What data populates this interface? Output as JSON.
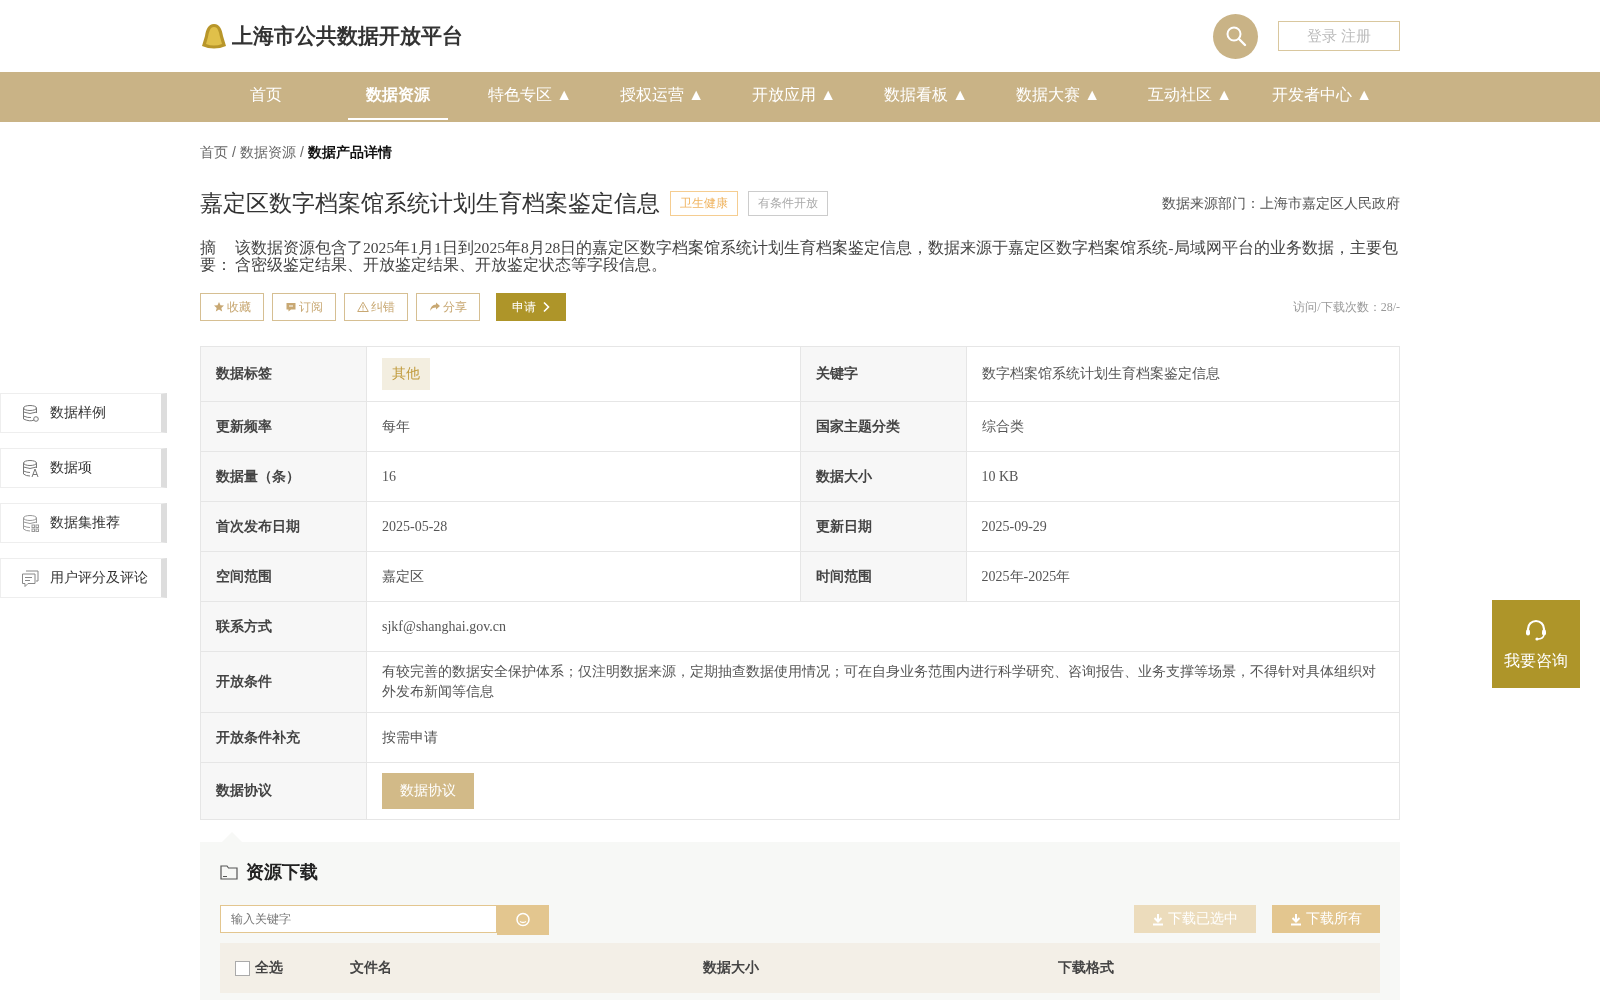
{
  "header": {
    "site_title": "上海市公共数据开放平台",
    "login_button": "登录 注册"
  },
  "nav": [
    {
      "label": "首页",
      "selected": false
    },
    {
      "label": "数据资源",
      "selected": true
    },
    {
      "label": "特色专区 ▲",
      "selected": false
    },
    {
      "label": "授权运营 ▲",
      "selected": false
    },
    {
      "label": "开放应用 ▲",
      "selected": false
    },
    {
      "label": "数据看板 ▲",
      "selected": false
    },
    {
      "label": "数据大赛 ▲",
      "selected": false
    },
    {
      "label": "互动社区 ▲",
      "selected": false
    },
    {
      "label": "开发者中心 ▲",
      "selected": false
    }
  ],
  "breadcrumb": [
    {
      "label": "首页",
      "current": false,
      "separator": "/"
    },
    {
      "label": "数据资源",
      "current": false,
      "separator": "/"
    },
    {
      "label": "数据产品详情",
      "current": true
    }
  ],
  "product": {
    "title": "嘉定区数字档案馆系统计划生育档案鉴定信息",
    "tags": [
      {
        "label": "卫生健康",
        "kind": "category"
      },
      {
        "label": "有条件开放",
        "kind": "access"
      }
    ],
    "source": "数据来源部门：上海市嘉定区人民政府",
    "abstract_label": "摘要：",
    "abstract": "该数据资源包含了2025年1月1日到2025年8月28日的嘉定区数字档案馆系统计划生育档案鉴定信息，数据来源于嘉定区数字档案馆系统-局域网平台的业务数据，主要包含密级鉴定结果、开放鉴定结果、开放鉴定状态等字段信息。",
    "actions": [
      {
        "label": "收藏",
        "kind": "star"
      },
      {
        "label": "订阅",
        "kind": "subscribe"
      },
      {
        "label": "纠错",
        "kind": "warning"
      },
      {
        "label": "分享",
        "kind": "share"
      },
      {
        "label": "申请",
        "kind": "apply"
      }
    ],
    "visits": "访问/下载次数：28/-"
  },
  "info_table": [
    {
      "fields": [
        {
          "label": "数据标签",
          "value": "其他",
          "kind": "tag"
        },
        {
          "label": "关键字",
          "value": "数字档案馆系统计划生育档案鉴定信息",
          "kind": "text"
        }
      ]
    },
    {
      "fields": [
        {
          "label": "更新频率",
          "value": "每年",
          "kind": "text"
        },
        {
          "label": "国家主题分类",
          "value": "综合类",
          "kind": "text"
        }
      ]
    },
    {
      "fields": [
        {
          "label": "数据量（条）",
          "value": "16",
          "kind": "text"
        },
        {
          "label": "数据大小",
          "value": "10 KB",
          "kind": "text"
        }
      ]
    },
    {
      "fields": [
        {
          "label": "首次发布日期",
          "value": "2025-05-28",
          "kind": "text"
        },
        {
          "label": "更新日期",
          "value": "2025-09-29",
          "kind": "text"
        }
      ]
    },
    {
      "fields": [
        {
          "label": "空间范围",
          "value": "嘉定区",
          "kind": "text"
        },
        {
          "label": "时间范围",
          "value": "2025年-2025年",
          "kind": "text"
        }
      ]
    },
    {
      "fields": [
        {
          "label": "联系方式",
          "value": "sjkf@shanghai.gov.cn",
          "kind": "text"
        }
      ]
    },
    {
      "fields": [
        {
          "label": "开放条件",
          "value": "有较完善的数据安全保护体系；仅注明数据来源，定期抽查数据使用情况；可在自身业务范围内进行科学研究、咨询报告、业务支撑等场景，不得针对具体组织对外发布新闻等信息",
          "kind": "text"
        }
      ]
    },
    {
      "fields": [
        {
          "label": "开放条件补充",
          "value": "按需申请",
          "kind": "text"
        }
      ]
    },
    {
      "fields": [
        {
          "label": "数据协议",
          "value": "数据协议",
          "kind": "button"
        }
      ]
    }
  ],
  "side_menu": [
    {
      "label": "数据样例",
      "kind": "sample"
    },
    {
      "label": "数据项",
      "kind": "items"
    },
    {
      "label": "数据集推荐",
      "kind": "recommend"
    },
    {
      "label": "用户评分及评论",
      "kind": "comment"
    }
  ],
  "consult_button": "我要咨询",
  "download": {
    "title": "资源下载",
    "search": {
      "placeholder": "输入关键字"
    },
    "buttons": [
      {
        "label": "下载已选中",
        "disabled": true
      },
      {
        "label": "下载所有",
        "disabled": false
      }
    ],
    "columns": [
      "全选",
      "文件名",
      "数据大小",
      "下载格式"
    ],
    "select_all": {
      "checked": false
    }
  }
}
